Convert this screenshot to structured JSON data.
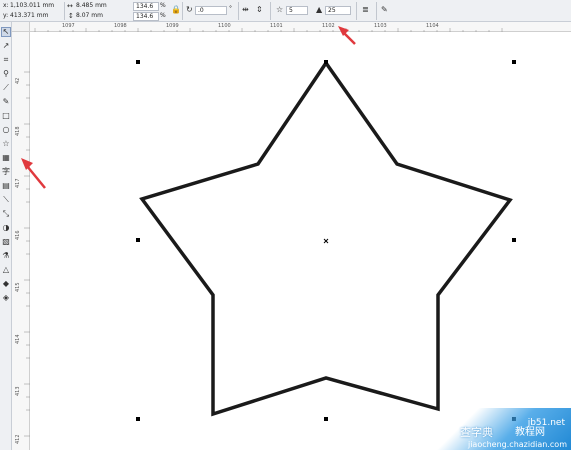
{
  "propbar": {
    "x_label": "x:",
    "x_value": "1,103.011 mm",
    "y_label": "y:",
    "y_value": "413.371 mm",
    "w_value": "8.485 mm",
    "h_value": "8.07 mm",
    "scale_x": "134.6",
    "scale_y": "134.6",
    "percent": "%",
    "rotation": ".0",
    "degree": "°",
    "points_count": "5",
    "sharpness": "25"
  },
  "hruler": {
    "ticks": [
      "1097",
      "1098",
      "1099",
      "1100",
      "1101",
      "1102",
      "1103",
      "1104"
    ]
  },
  "vruler": {
    "ticks": [
      "42",
      "418",
      "417",
      "416",
      "415",
      "414",
      "413",
      "412"
    ]
  },
  "watermark": {
    "line1": "jb51.net",
    "line2": "教程网",
    "line3": "jiaocheng.chazidian.com",
    "line4": "查字典"
  },
  "colors": {
    "star_stroke": "#1a1a1a",
    "annotation_arrow": "#e0393e",
    "toolbar_bg": "#eef0f3"
  }
}
